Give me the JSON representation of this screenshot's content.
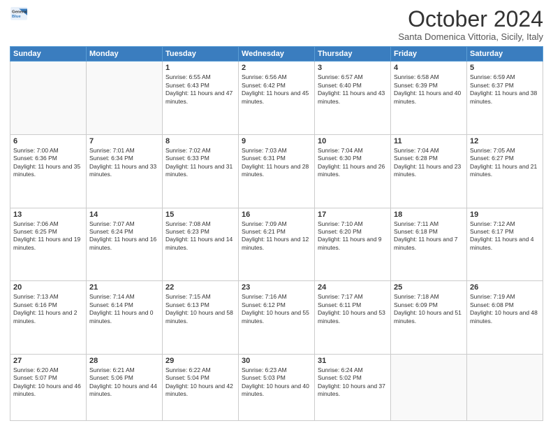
{
  "header": {
    "logo_line1": "General",
    "logo_line2": "Blue",
    "title": "October 2024",
    "subtitle": "Santa Domenica Vittoria, Sicily, Italy"
  },
  "weekdays": [
    "Sunday",
    "Monday",
    "Tuesday",
    "Wednesday",
    "Thursday",
    "Friday",
    "Saturday"
  ],
  "weeks": [
    [
      {
        "day": "",
        "empty": true
      },
      {
        "day": "",
        "empty": true
      },
      {
        "day": "1",
        "sunrise": "Sunrise: 6:55 AM",
        "sunset": "Sunset: 6:43 PM",
        "daylight": "Daylight: 11 hours and 47 minutes."
      },
      {
        "day": "2",
        "sunrise": "Sunrise: 6:56 AM",
        "sunset": "Sunset: 6:42 PM",
        "daylight": "Daylight: 11 hours and 45 minutes."
      },
      {
        "day": "3",
        "sunrise": "Sunrise: 6:57 AM",
        "sunset": "Sunset: 6:40 PM",
        "daylight": "Daylight: 11 hours and 43 minutes."
      },
      {
        "day": "4",
        "sunrise": "Sunrise: 6:58 AM",
        "sunset": "Sunset: 6:39 PM",
        "daylight": "Daylight: 11 hours and 40 minutes."
      },
      {
        "day": "5",
        "sunrise": "Sunrise: 6:59 AM",
        "sunset": "Sunset: 6:37 PM",
        "daylight": "Daylight: 11 hours and 38 minutes."
      }
    ],
    [
      {
        "day": "6",
        "sunrise": "Sunrise: 7:00 AM",
        "sunset": "Sunset: 6:36 PM",
        "daylight": "Daylight: 11 hours and 35 minutes."
      },
      {
        "day": "7",
        "sunrise": "Sunrise: 7:01 AM",
        "sunset": "Sunset: 6:34 PM",
        "daylight": "Daylight: 11 hours and 33 minutes."
      },
      {
        "day": "8",
        "sunrise": "Sunrise: 7:02 AM",
        "sunset": "Sunset: 6:33 PM",
        "daylight": "Daylight: 11 hours and 31 minutes."
      },
      {
        "day": "9",
        "sunrise": "Sunrise: 7:03 AM",
        "sunset": "Sunset: 6:31 PM",
        "daylight": "Daylight: 11 hours and 28 minutes."
      },
      {
        "day": "10",
        "sunrise": "Sunrise: 7:04 AM",
        "sunset": "Sunset: 6:30 PM",
        "daylight": "Daylight: 11 hours and 26 minutes."
      },
      {
        "day": "11",
        "sunrise": "Sunrise: 7:04 AM",
        "sunset": "Sunset: 6:28 PM",
        "daylight": "Daylight: 11 hours and 23 minutes."
      },
      {
        "day": "12",
        "sunrise": "Sunrise: 7:05 AM",
        "sunset": "Sunset: 6:27 PM",
        "daylight": "Daylight: 11 hours and 21 minutes."
      }
    ],
    [
      {
        "day": "13",
        "sunrise": "Sunrise: 7:06 AM",
        "sunset": "Sunset: 6:25 PM",
        "daylight": "Daylight: 11 hours and 19 minutes."
      },
      {
        "day": "14",
        "sunrise": "Sunrise: 7:07 AM",
        "sunset": "Sunset: 6:24 PM",
        "daylight": "Daylight: 11 hours and 16 minutes."
      },
      {
        "day": "15",
        "sunrise": "Sunrise: 7:08 AM",
        "sunset": "Sunset: 6:23 PM",
        "daylight": "Daylight: 11 hours and 14 minutes."
      },
      {
        "day": "16",
        "sunrise": "Sunrise: 7:09 AM",
        "sunset": "Sunset: 6:21 PM",
        "daylight": "Daylight: 11 hours and 12 minutes."
      },
      {
        "day": "17",
        "sunrise": "Sunrise: 7:10 AM",
        "sunset": "Sunset: 6:20 PM",
        "daylight": "Daylight: 11 hours and 9 minutes."
      },
      {
        "day": "18",
        "sunrise": "Sunrise: 7:11 AM",
        "sunset": "Sunset: 6:18 PM",
        "daylight": "Daylight: 11 hours and 7 minutes."
      },
      {
        "day": "19",
        "sunrise": "Sunrise: 7:12 AM",
        "sunset": "Sunset: 6:17 PM",
        "daylight": "Daylight: 11 hours and 4 minutes."
      }
    ],
    [
      {
        "day": "20",
        "sunrise": "Sunrise: 7:13 AM",
        "sunset": "Sunset: 6:16 PM",
        "daylight": "Daylight: 11 hours and 2 minutes."
      },
      {
        "day": "21",
        "sunrise": "Sunrise: 7:14 AM",
        "sunset": "Sunset: 6:14 PM",
        "daylight": "Daylight: 11 hours and 0 minutes."
      },
      {
        "day": "22",
        "sunrise": "Sunrise: 7:15 AM",
        "sunset": "Sunset: 6:13 PM",
        "daylight": "Daylight: 10 hours and 58 minutes."
      },
      {
        "day": "23",
        "sunrise": "Sunrise: 7:16 AM",
        "sunset": "Sunset: 6:12 PM",
        "daylight": "Daylight: 10 hours and 55 minutes."
      },
      {
        "day": "24",
        "sunrise": "Sunrise: 7:17 AM",
        "sunset": "Sunset: 6:11 PM",
        "daylight": "Daylight: 10 hours and 53 minutes."
      },
      {
        "day": "25",
        "sunrise": "Sunrise: 7:18 AM",
        "sunset": "Sunset: 6:09 PM",
        "daylight": "Daylight: 10 hours and 51 minutes."
      },
      {
        "day": "26",
        "sunrise": "Sunrise: 7:19 AM",
        "sunset": "Sunset: 6:08 PM",
        "daylight": "Daylight: 10 hours and 48 minutes."
      }
    ],
    [
      {
        "day": "27",
        "sunrise": "Sunrise: 6:20 AM",
        "sunset": "Sunset: 5:07 PM",
        "daylight": "Daylight: 10 hours and 46 minutes."
      },
      {
        "day": "28",
        "sunrise": "Sunrise: 6:21 AM",
        "sunset": "Sunset: 5:06 PM",
        "daylight": "Daylight: 10 hours and 44 minutes."
      },
      {
        "day": "29",
        "sunrise": "Sunrise: 6:22 AM",
        "sunset": "Sunset: 5:04 PM",
        "daylight": "Daylight: 10 hours and 42 minutes."
      },
      {
        "day": "30",
        "sunrise": "Sunrise: 6:23 AM",
        "sunset": "Sunset: 5:03 PM",
        "daylight": "Daylight: 10 hours and 40 minutes."
      },
      {
        "day": "31",
        "sunrise": "Sunrise: 6:24 AM",
        "sunset": "Sunset: 5:02 PM",
        "daylight": "Daylight: 10 hours and 37 minutes."
      },
      {
        "day": "",
        "empty": true
      },
      {
        "day": "",
        "empty": true
      }
    ]
  ]
}
